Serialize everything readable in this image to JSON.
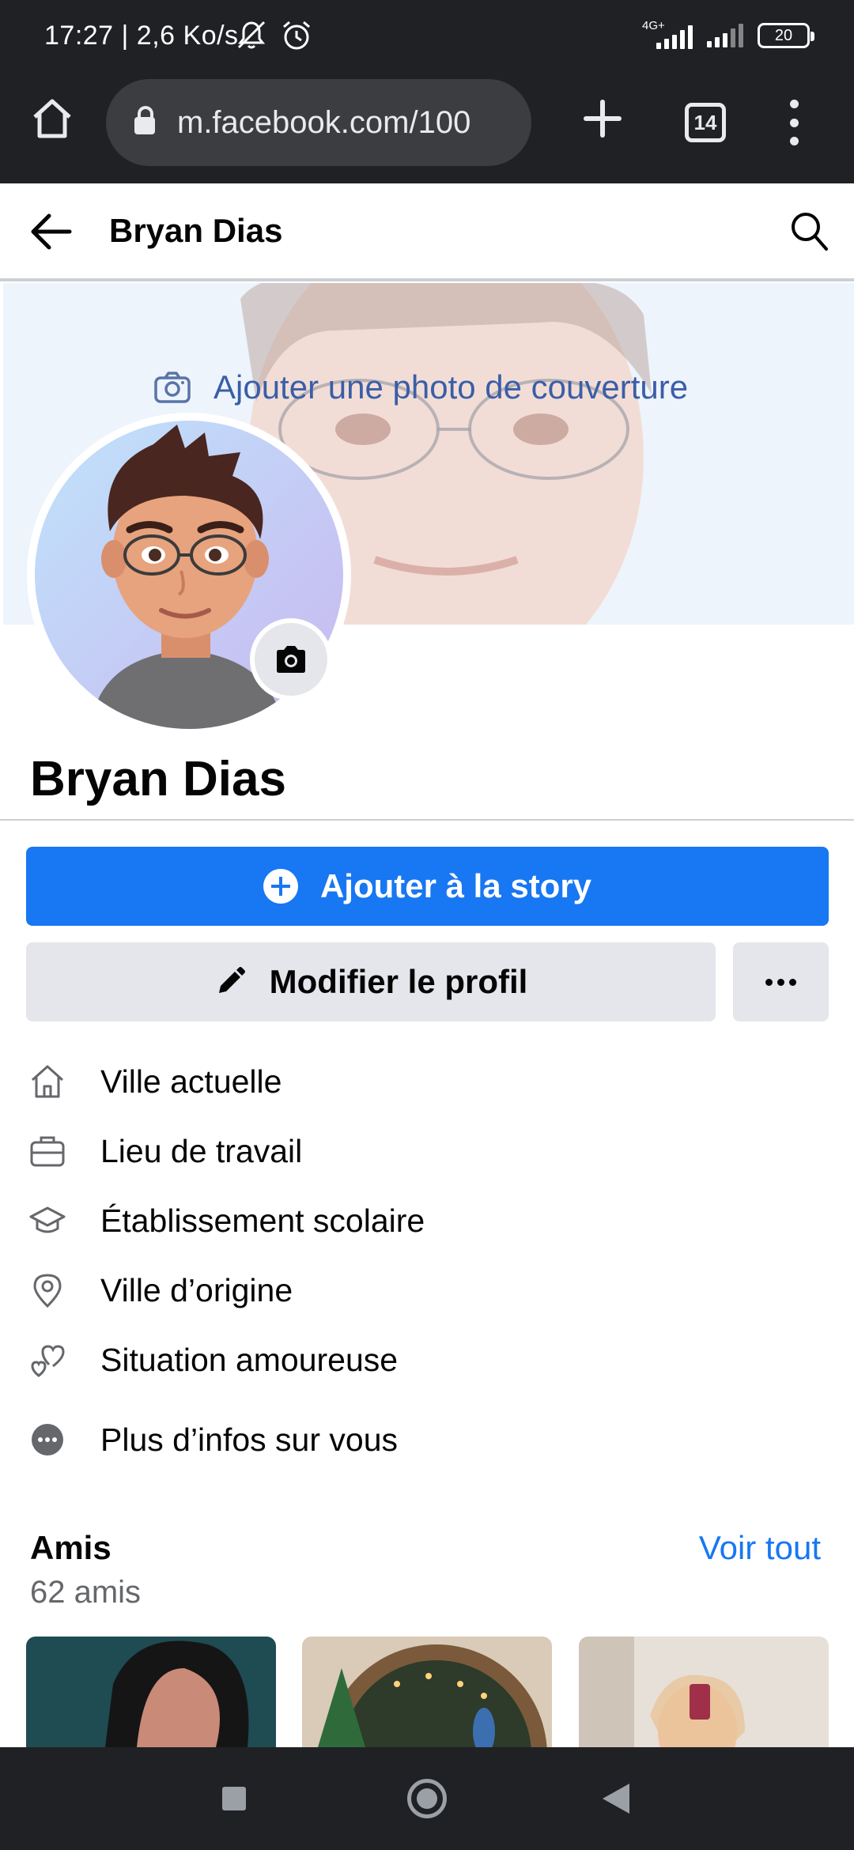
{
  "status_bar": {
    "time_speed": "17:27 | 2,6 Ko/s",
    "network": "4G+",
    "battery": "20",
    "icons": [
      "mute-bell-icon",
      "alarm-icon",
      "signal-icon",
      "signal-icon",
      "battery-icon"
    ]
  },
  "browser": {
    "url": "m.facebook.com/100",
    "tab_count": "14",
    "icons": [
      "home-icon",
      "lock-icon",
      "plus-icon",
      "tabs-icon",
      "menu-icon"
    ]
  },
  "header": {
    "title": "Bryan Dias",
    "icons": [
      "back-arrow-icon",
      "search-icon"
    ]
  },
  "cover": {
    "cta": "Ajouter une photo de couverture",
    "icon": "camera-icon"
  },
  "profile": {
    "name": "Bryan Dias"
  },
  "actions": {
    "story_label": "Ajouter à la story",
    "edit_label": "Modifier le profil",
    "more_icon": "more-dots-icon"
  },
  "info": [
    {
      "label": "Ville actuelle",
      "icon": "home-outline-icon"
    },
    {
      "label": "Lieu de travail",
      "icon": "briefcase-icon"
    },
    {
      "label": "Établissement scolaire",
      "icon": "graduation-cap-icon"
    },
    {
      "label": "Ville d’origine",
      "icon": "location-pin-icon"
    },
    {
      "label": "Situation amoureuse",
      "icon": "hearts-icon"
    },
    {
      "label": "Plus d’infos sur vous",
      "icon": "more-circle-icon"
    }
  ],
  "friends": {
    "title": "Amis",
    "count": "62 amis",
    "see_all": "Voir tout"
  },
  "colors": {
    "brand_blue": "#1877f2",
    "chrome_dark": "#202124",
    "button_grey": "#e4e6eb",
    "secondary_text": "#65676b"
  }
}
